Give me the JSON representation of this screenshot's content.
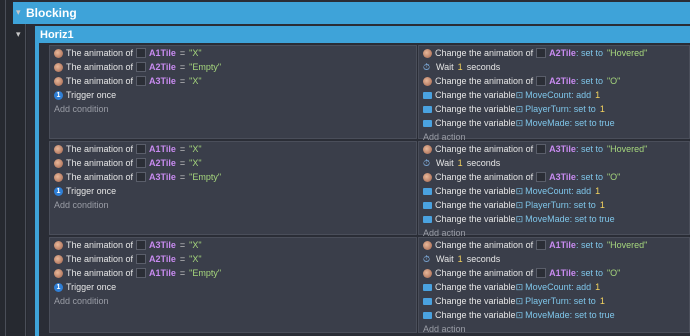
{
  "group": {
    "title": "Blocking",
    "toggle": "▾"
  },
  "subgroup": {
    "title": "Horiz1",
    "toggle": "▾"
  },
  "add_condition": "Add condition",
  "add_action": "Add action",
  "events": [
    {
      "conditions": [
        {
          "kind": "anim",
          "prefix": "The animation of",
          "object": "A1Tile",
          "op": "=",
          "value": "\"X\""
        },
        {
          "kind": "anim",
          "prefix": "The animation of",
          "object": "A2Tile",
          "op": "=",
          "value": "\"Empty\""
        },
        {
          "kind": "anim",
          "prefix": "The animation of",
          "object": "A3Tile",
          "op": "=",
          "value": "\"X\""
        },
        {
          "kind": "once",
          "prefix": "Trigger once"
        }
      ],
      "actions": [
        {
          "kind": "anim",
          "prefix": "Change the animation of",
          "object": "A2Tile",
          "suffix": ": set to",
          "value": "\"Hovered\""
        },
        {
          "kind": "wait",
          "prefix": "Wait",
          "value": "1",
          "suffix": "seconds"
        },
        {
          "kind": "anim",
          "prefix": "Change the animation of",
          "object": "A2Tile",
          "suffix": ": set to",
          "value": "\"O\""
        },
        {
          "kind": "var",
          "prefix": "Change the variable",
          "variable": "MoveCount",
          "suffix": ": add",
          "value": "1"
        },
        {
          "kind": "var",
          "prefix": "Change the variable",
          "variable": "PlayerTurn",
          "suffix": ": set to",
          "value": "1"
        },
        {
          "kind": "var",
          "prefix": "Change the variable",
          "variable": "MoveMade",
          "suffix": ": set to true",
          "value": ""
        }
      ]
    },
    {
      "conditions": [
        {
          "kind": "anim",
          "prefix": "The animation of",
          "object": "A1Tile",
          "op": "=",
          "value": "\"X\""
        },
        {
          "kind": "anim",
          "prefix": "The animation of",
          "object": "A2Tile",
          "op": "=",
          "value": "\"X\""
        },
        {
          "kind": "anim",
          "prefix": "The animation of",
          "object": "A3Tile",
          "op": "=",
          "value": "\"Empty\""
        },
        {
          "kind": "once",
          "prefix": "Trigger once"
        }
      ],
      "actions": [
        {
          "kind": "anim",
          "prefix": "Change the animation of",
          "object": "A3Tile",
          "suffix": ": set to",
          "value": "\"Hovered\""
        },
        {
          "kind": "wait",
          "prefix": "Wait",
          "value": "1",
          "suffix": "seconds"
        },
        {
          "kind": "anim",
          "prefix": "Change the animation of",
          "object": "A3Tile",
          "suffix": ": set to",
          "value": "\"O\""
        },
        {
          "kind": "var",
          "prefix": "Change the variable",
          "variable": "MoveCount",
          "suffix": ": add",
          "value": "1"
        },
        {
          "kind": "var",
          "prefix": "Change the variable",
          "variable": "PlayerTurn",
          "suffix": ": set to",
          "value": "1"
        },
        {
          "kind": "var",
          "prefix": "Change the variable",
          "variable": "MoveMade",
          "suffix": ": set to true",
          "value": ""
        }
      ]
    },
    {
      "conditions": [
        {
          "kind": "anim",
          "prefix": "The animation of",
          "object": "A3Tile",
          "op": "=",
          "value": "\"X\""
        },
        {
          "kind": "anim",
          "prefix": "The animation of",
          "object": "A2Tile",
          "op": "=",
          "value": "\"X\""
        },
        {
          "kind": "anim",
          "prefix": "The animation of",
          "object": "A1Tile",
          "op": "=",
          "value": "\"Empty\""
        },
        {
          "kind": "once",
          "prefix": "Trigger once"
        }
      ],
      "actions": [
        {
          "kind": "anim",
          "prefix": "Change the animation of",
          "object": "A1Tile",
          "suffix": ": set to",
          "value": "\"Hovered\""
        },
        {
          "kind": "wait",
          "prefix": "Wait",
          "value": "1",
          "suffix": "seconds"
        },
        {
          "kind": "anim",
          "prefix": "Change the animation of",
          "object": "A1Tile",
          "suffix": ": set to",
          "value": "\"O\""
        },
        {
          "kind": "var",
          "prefix": "Change the variable",
          "variable": "MoveCount",
          "suffix": ": add",
          "value": "1"
        },
        {
          "kind": "var",
          "prefix": "Change the variable",
          "variable": "PlayerTurn",
          "suffix": ": set to",
          "value": "1"
        },
        {
          "kind": "var",
          "prefix": "Change the variable",
          "variable": "MoveMade",
          "suffix": ": set to true",
          "value": ""
        }
      ]
    }
  ]
}
